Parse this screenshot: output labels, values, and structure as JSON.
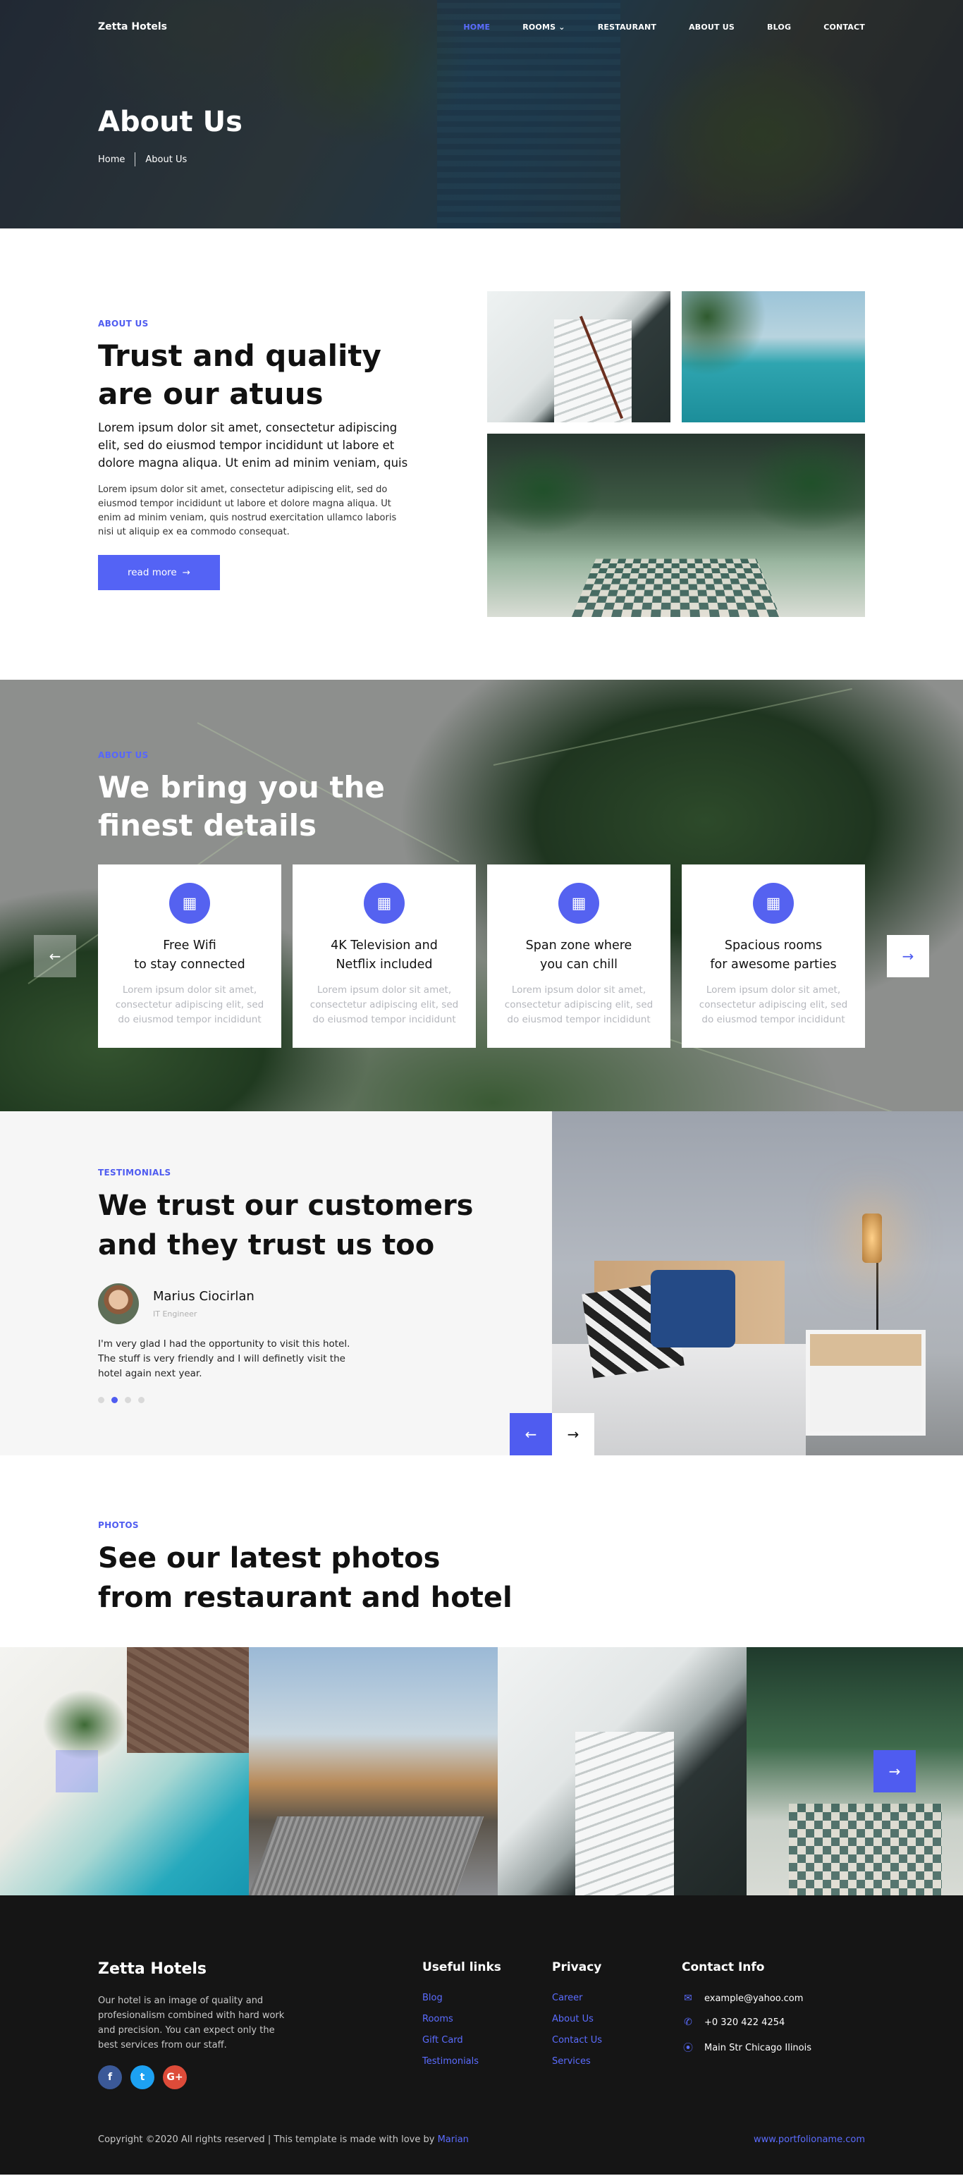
{
  "nav": {
    "logo": "Zetta Hotels",
    "items": [
      "HOME",
      "ROOMS",
      "RESTAURANT",
      "ABOUT US",
      "BLOG",
      "CONTACT"
    ],
    "rooms_caret": "⌄"
  },
  "hero": {
    "title": "About Us",
    "breadcrumb": [
      "Home",
      "About Us"
    ]
  },
  "about": {
    "eyebrow": "ABOUT US",
    "title_line1": "Trust and quality",
    "title_line2": "are our atuus",
    "lead": "Lorem ipsum dolor sit amet, consectetur adipiscing elit, sed do eiusmod tempor incididunt ut labore et dolore magna aliqua. Ut enim ad minim veniam, quis",
    "body": "Lorem ipsum dolor sit amet, consectetur adipiscing elit, sed do eiusmod tempor incididunt ut labore et dolore magna aliqua. Ut enim ad minim veniam, quis nostrud exercitation ullamco laboris nisi ut aliquip ex ea commodo consequat.",
    "button": "read more",
    "button_arrow": "→"
  },
  "details": {
    "eyebrow": "ABOUT US",
    "title_line1": "We bring you the",
    "title_line2": "finest details",
    "cards": [
      {
        "title1": "Free Wifi",
        "title2": "to stay connected",
        "desc": "Lorem ipsum dolor sit amet, consectetur adipiscing elit, sed do eiusmod tempor incididunt"
      },
      {
        "title1": "4K Television and",
        "title2": "Netflix included",
        "desc": "Lorem ipsum dolor sit amet, consectetur adipiscing elit, sed do eiusmod tempor incididunt"
      },
      {
        "title1": "Span zone where",
        "title2": "you can chill",
        "desc": "Lorem ipsum dolor sit amet, consectetur adipiscing elit, sed do eiusmod tempor incididunt"
      },
      {
        "title1": "Spacious rooms",
        "title2": "for awesome parties",
        "desc": "Lorem ipsum dolor sit amet, consectetur adipiscing elit, sed do eiusmod tempor incididunt"
      }
    ],
    "icon": "building-icon",
    "prev": "←",
    "next": "→"
  },
  "testimonials": {
    "eyebrow": "TESTIMONIALS",
    "title_line1": "We trust our customers",
    "title_line2": "and they trust us too",
    "name": "Marius Ciocirlan",
    "role": "IT Engineer",
    "quote": "I'm very glad I had the opportunity to visit this hotel. The stuff is very friendly and I will definetly visit the hotel again next year.",
    "active_dot": 2,
    "dot_count": 4,
    "prev": "←",
    "next": "→"
  },
  "photos": {
    "eyebrow": "PHOTOS",
    "title_line1": "See our latest photos",
    "title_line2": "from restaurant and hotel",
    "next": "→"
  },
  "footer": {
    "brand": "Zetta Hotels",
    "about": "Our hotel is an image of quality and profesionalism combined with hard work and precision. You can expect only the best services from our staff.",
    "socials": [
      "f",
      "t",
      "G+"
    ],
    "useful_title": "Useful links",
    "useful": [
      "Blog",
      "Rooms",
      "Gift Card",
      "Testimonials"
    ],
    "privacy_title": "Privacy",
    "privacy": [
      "Career",
      "About Us",
      "Contact Us",
      "Services"
    ],
    "contact_title": "Contact Info",
    "contact": [
      "example@yahoo.com",
      "+0 320 422 4254",
      "Main Str Chicago Ilinois"
    ],
    "copyright": "Copyright ©2020 All rights reserved | This template is made with love by",
    "author": "Marian",
    "site": "www.portfolioname.com"
  },
  "colors": {
    "accent": "#4f5cf0",
    "footer_bg": "#151515"
  }
}
